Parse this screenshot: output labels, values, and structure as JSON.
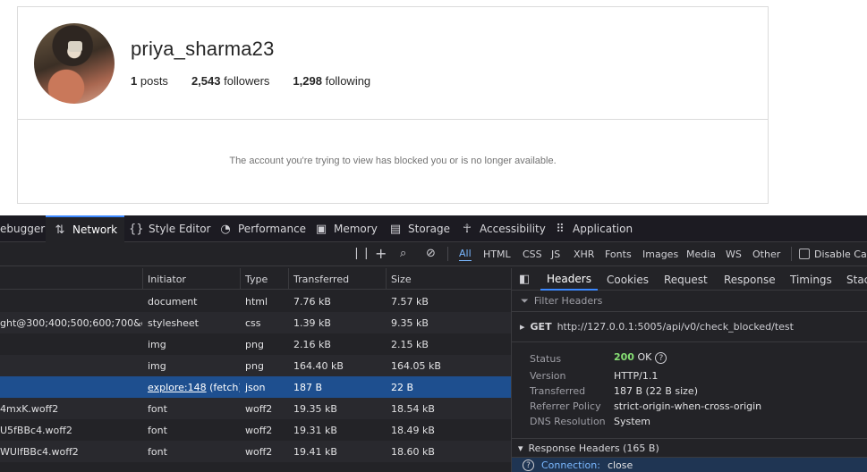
{
  "profile": {
    "username": "priya_sharma23",
    "posts_count": "1",
    "posts_label": "posts",
    "followers_count": "2,543",
    "followers_label": "followers",
    "following_count": "1,298",
    "following_label": "following",
    "blocked_message": "The account you're trying to view has blocked you or is no longer available."
  },
  "devtools": {
    "tabs": [
      "ebugger",
      "Network",
      "Style Editor",
      "Performance",
      "Memory",
      "Storage",
      "Accessibility",
      "Application"
    ],
    "filters": [
      "All",
      "HTML",
      "CSS",
      "JS",
      "XHR",
      "Fonts",
      "Images",
      "Media",
      "WS",
      "Other"
    ],
    "disable_cache_label": "Disable Cach",
    "columns": [
      "Initiator",
      "Type",
      "Transferred",
      "Size"
    ],
    "rows": [
      {
        "file": "",
        "initiator": "document",
        "type": "html",
        "transferred": "7.76 kB",
        "size": "7.57 kB"
      },
      {
        "file": "ght@300;400;500;600;700&disp",
        "initiator": "stylesheet",
        "type": "css",
        "transferred": "1.39 kB",
        "size": "9.35 kB"
      },
      {
        "file": "",
        "initiator": "img",
        "type": "png",
        "transferred": "2.16 kB",
        "size": "2.15 kB"
      },
      {
        "file": "",
        "initiator": "img",
        "type": "png",
        "transferred": "164.40 kB",
        "size": "164.05 kB"
      },
      {
        "file": "",
        "initiator": "explore:148",
        "initiator_suffix": " (fetch)",
        "type": "json",
        "transferred": "187 B",
        "size": "22 B"
      },
      {
        "file": "4mxK.woff2",
        "initiator": "font",
        "type": "woff2",
        "transferred": "19.35 kB",
        "size": "18.54 kB"
      },
      {
        "file": "U5fBBc4.woff2",
        "initiator": "font",
        "type": "woff2",
        "transferred": "19.31 kB",
        "size": "18.49 kB"
      },
      {
        "file": "WUlfBBc4.woff2",
        "initiator": "font",
        "type": "woff2",
        "transferred": "19.41 kB",
        "size": "18.60 kB"
      }
    ],
    "sidebar": {
      "tabs": [
        "Headers",
        "Cookies",
        "Request",
        "Response",
        "Timings",
        "Stac"
      ],
      "filter_placeholder": "Filter Headers",
      "method": "GET",
      "url": "http://127.0.0.1:5005/api/v0/check_blocked/test",
      "status_label": "Status",
      "status_code": "200",
      "status_text": "OK",
      "version_label": "Version",
      "version": "HTTP/1.1",
      "transferred_label": "Transferred",
      "transferred": "187 B (22 B size)",
      "referrer_label": "Referrer Policy",
      "referrer": "strict-origin-when-cross-origin",
      "dns_label": "DNS Resolution",
      "dns": "System",
      "response_headers": "Response Headers (165 B)",
      "conn_name": "Connection:",
      "conn_value": "close"
    }
  }
}
